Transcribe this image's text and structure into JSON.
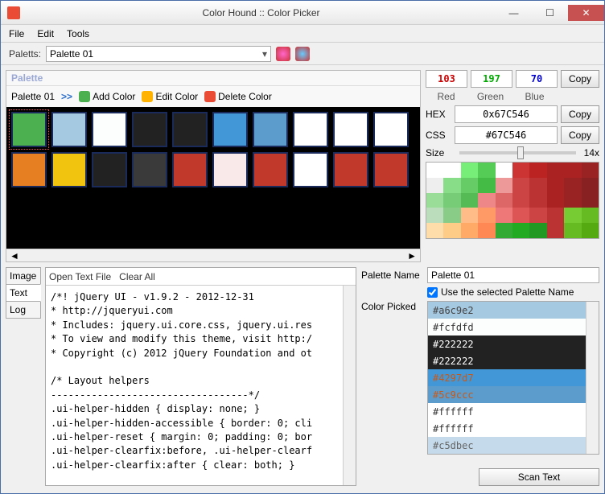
{
  "window": {
    "title": "Color Hound :: Color Picker"
  },
  "menu": {
    "file": "File",
    "edit": "Edit",
    "tools": "Tools"
  },
  "palettes": {
    "label": "Paletts:",
    "selected": "Palette 01"
  },
  "palette": {
    "header": "Palette",
    "name": "Palette 01",
    "add": "Add Color",
    "edit": "Edit Color",
    "delete": "Delete Color",
    "row1": [
      "#4caf50",
      "#a6c9e2",
      "#fcfdfd",
      "#222222",
      "#222222",
      "#4297d7",
      "#5c9ccc",
      "#ffffff",
      "#ffffff",
      "#ffffff"
    ],
    "row2": [
      "#e67e22",
      "#f1c40f",
      "#222222",
      "#3a3a3a",
      "#c0392b",
      "#f9e9e9",
      "#c0392b",
      "#ffffff",
      "#c0392b",
      "#c0392b"
    ]
  },
  "rgb": {
    "r": "103",
    "g": "197",
    "b": "70",
    "rl": "Red",
    "gl": "Green",
    "bl": "Blue",
    "copy": "Copy"
  },
  "hex": {
    "label": "HEX",
    "value": "0x67C546"
  },
  "css": {
    "label": "CSS",
    "value": "#67C546"
  },
  "size": {
    "label": "Size",
    "value": "14x"
  },
  "tabs": {
    "image": "Image",
    "text": "Text",
    "log": "Log"
  },
  "textbar": {
    "open": "Open Text File",
    "clear": "Clear All"
  },
  "code": "/*! jQuery UI - v1.9.2 - 2012-12-31\n* http://jqueryui.com\n* Includes: jquery.ui.core.css, jquery.ui.res\n* To view and modify this theme, visit http:/\n* Copyright (c) 2012 jQuery Foundation and ot\n\n/* Layout helpers\n----------------------------------*/\n.ui-helper-hidden { display: none; }\n.ui-helper-hidden-accessible { border: 0; cli\n.ui-helper-reset { margin: 0; padding: 0; bor\n.ui-helper-clearfix:before, .ui-helper-clearf\n.ui-helper-clearfix:after { clear: both; }",
  "pname": {
    "label": "Palette Name",
    "value": "Palette 01",
    "chk": "Use the selected Palette Name"
  },
  "cpicked": {
    "label": "Color Picked",
    "items": [
      {
        "hex": "#a6c9e2",
        "bg": "#a6c9e2",
        "fg": "#444"
      },
      {
        "hex": "#fcfdfd",
        "bg": "#fcfdfd",
        "fg": "#333"
      },
      {
        "hex": "#222222",
        "bg": "#222222",
        "fg": "#fff"
      },
      {
        "hex": "#222222",
        "bg": "#222222",
        "fg": "#fff"
      },
      {
        "hex": "#4297d7",
        "bg": "#4297d7",
        "fg": "#c75a1a"
      },
      {
        "hex": "#5c9ccc",
        "bg": "#5c9ccc",
        "fg": "#c75a1a"
      },
      {
        "hex": "#ffffff",
        "bg": "#ffffff",
        "fg": "#333"
      },
      {
        "hex": "#ffffff",
        "bg": "#ffffff",
        "fg": "#333"
      },
      {
        "hex": "#c5dbec",
        "bg": "#c5dbec",
        "fg": "#666"
      }
    ]
  },
  "scan": "Scan Text"
}
